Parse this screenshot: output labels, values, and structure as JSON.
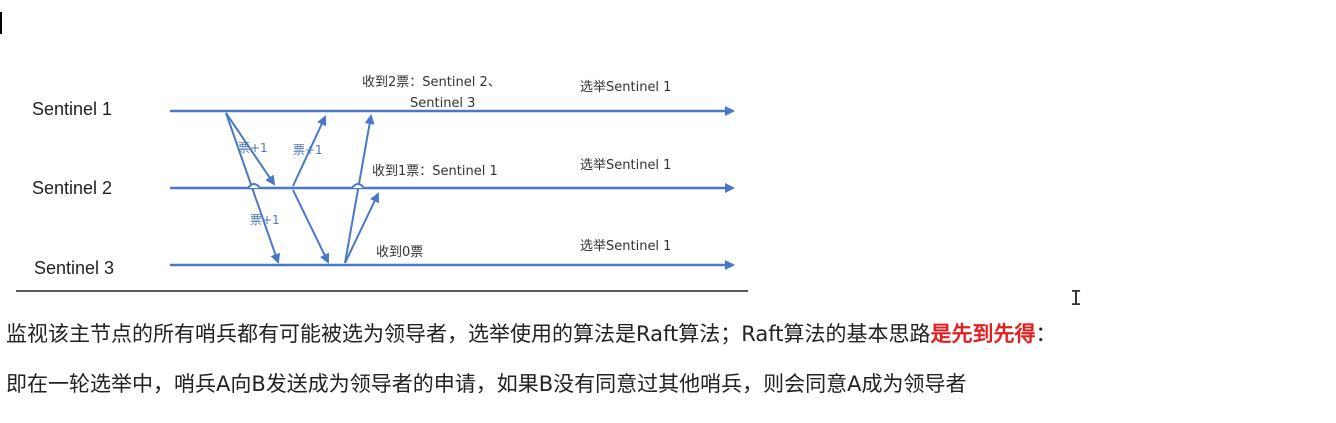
{
  "diagram": {
    "nodes": [
      {
        "label": "Sentinel 1"
      },
      {
        "label": "Sentinel 2"
      },
      {
        "label": "Sentinel 3"
      }
    ],
    "annotations": {
      "s1_votes_line1": "收到2票：Sentinel 2、",
      "s1_votes_line2": "Sentinel 3",
      "s2_votes": "收到1票：Sentinel 1",
      "s3_votes": "收到0票",
      "elect_s1": "选举Sentinel 1",
      "elect_s2": "选举Sentinel 1",
      "elect_s3": "选举Sentinel 1"
    },
    "vote_labels": [
      "票+1",
      "票+1",
      "票+1"
    ],
    "line_color": "#4a78c8"
  },
  "text": {
    "para1_prefix": "监视该主节点的所有哨兵都有可能被选为领导者，选举使用的算法是Raft算法；Raft算法的基本思路",
    "para1_highlight": "是先到先得",
    "para1_suffix": "：",
    "para2": "即在一轮选举中，哨兵A向B发送成为领导者的申请，如果B没有同意过其他哨兵，则会同意A成为领导者"
  },
  "colors": {
    "highlight": "#e02020",
    "arrows": "#4a78c8"
  }
}
